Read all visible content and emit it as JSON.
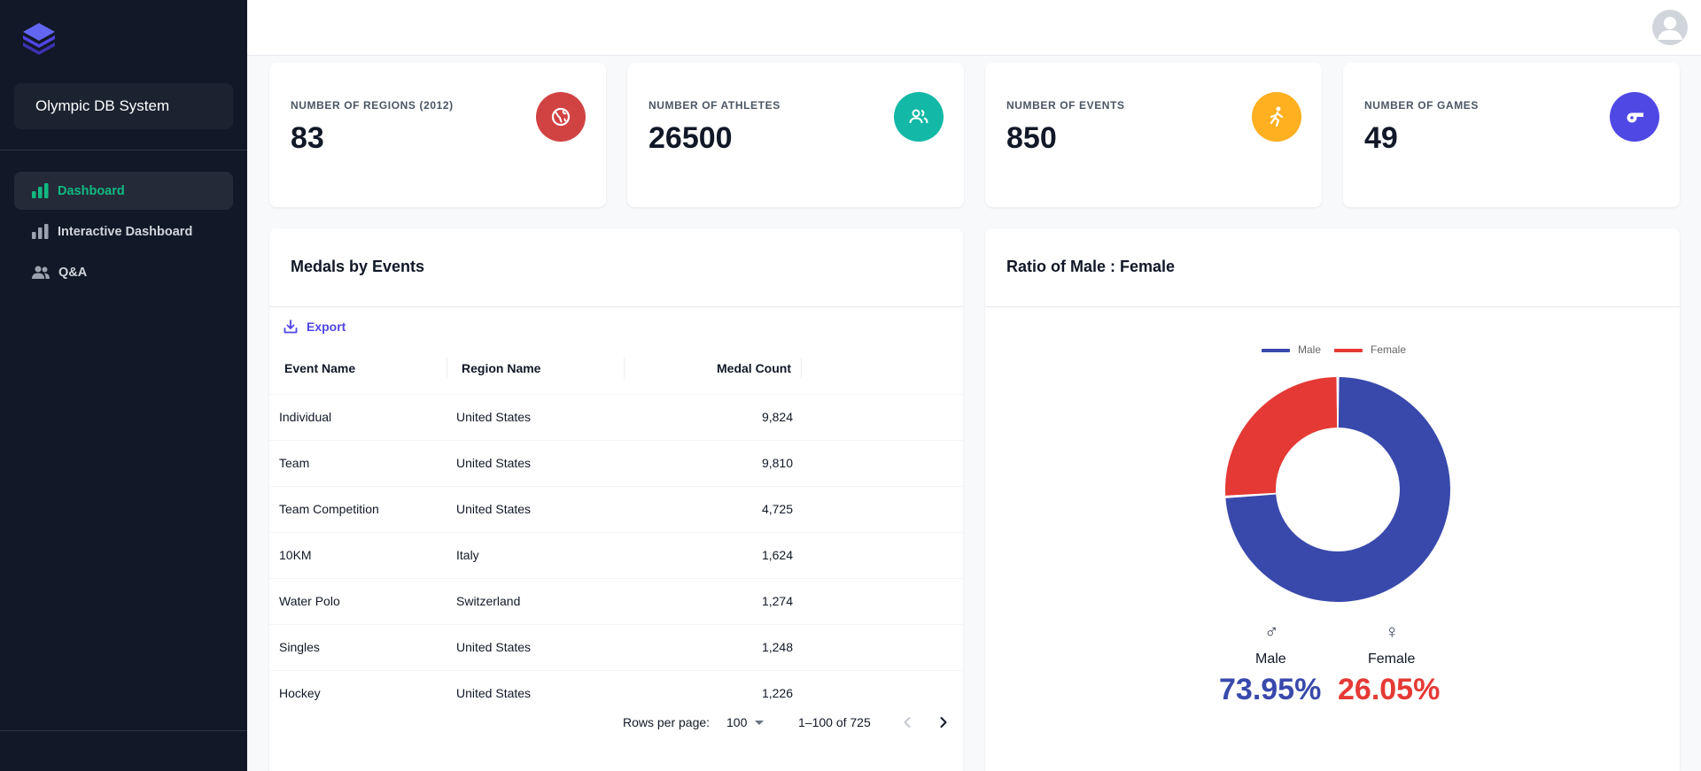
{
  "app": {
    "name": "Olympic DB System"
  },
  "sidebar": {
    "items": [
      {
        "label": "Dashboard",
        "active": true,
        "icon": "bar-chart-icon"
      },
      {
        "label": "Interactive Dashboard",
        "active": false,
        "icon": "bar-chart-icon"
      },
      {
        "label": "Q&A",
        "active": false,
        "icon": "users-icon"
      }
    ]
  },
  "stats": [
    {
      "label": "NUMBER OF REGIONS (2012)",
      "value": "83",
      "icon": "globe-icon",
      "color": "#d14343"
    },
    {
      "label": "NUMBER OF ATHLETES",
      "value": "26500",
      "icon": "people-icon",
      "color": "#14b8a6"
    },
    {
      "label": "NUMBER OF EVENTS",
      "value": "850",
      "icon": "runner-icon",
      "color": "#ffb020"
    },
    {
      "label": "NUMBER OF GAMES",
      "value": "49",
      "icon": "whistle-icon",
      "color": "#5048e5"
    }
  ],
  "medals_table": {
    "title": "Medals by Events",
    "export_label": "Export",
    "columns": [
      "Event Name",
      "Region Name",
      "Medal Count"
    ],
    "rows": [
      [
        "Individual",
        "United States",
        "9,824"
      ],
      [
        "Team",
        "United States",
        "9,810"
      ],
      [
        "Team Competition",
        "United States",
        "4,725"
      ],
      [
        "10KM",
        "Italy",
        "1,624"
      ],
      [
        "Water Polo",
        "Switzerland",
        "1,274"
      ],
      [
        "Singles",
        "United States",
        "1,248"
      ],
      [
        "Hockey",
        "United States",
        "1,226"
      ]
    ],
    "pagination": {
      "rows_per_page_label": "Rows per page:",
      "rows_per_page": "100",
      "range": "1–100 of 725"
    }
  },
  "ratio_chart": {
    "title": "Ratio of Male : Female",
    "male": {
      "label": "Male",
      "symbol": "♂",
      "percent": "73.95%",
      "color": "#3949ab"
    },
    "female": {
      "label": "Female",
      "symbol": "♀",
      "percent": "26.05%",
      "color": "#e53935"
    }
  },
  "chart_data": {
    "type": "pie",
    "categories": [
      "Male",
      "Female"
    ],
    "values": [
      73.95,
      26.05
    ],
    "colors": [
      "#3949ab",
      "#e53935"
    ],
    "legend": [
      "Male",
      "Female"
    ],
    "legend_position": "top"
  }
}
